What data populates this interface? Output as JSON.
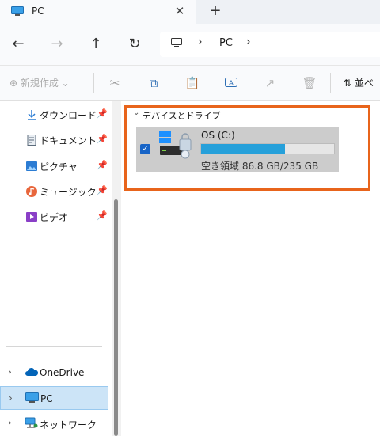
{
  "tab": {
    "title": "PC",
    "close_glyph": "✕",
    "new_tab_glyph": "+"
  },
  "nav": {
    "back_glyph": "←",
    "forward_glyph": "→",
    "up_glyph": "↑",
    "refresh_glyph": "↻",
    "breadcrumb": {
      "separator": "›",
      "location": "PC"
    }
  },
  "commands": {
    "new_label": "⊕ 新規作成 ⌄",
    "cut_glyph": "✂",
    "copy_glyph": "⧉",
    "paste_glyph": "📋",
    "rename_glyph": "A",
    "share_glyph": "↗",
    "delete_glyph": "🗑",
    "sort_label": "⇅ 並べ"
  },
  "sidebar": {
    "quick_access": [
      {
        "label": "ダウンロード",
        "icon": "download-icon"
      },
      {
        "label": "ドキュメント",
        "icon": "document-icon"
      },
      {
        "label": "ピクチャ",
        "icon": "picture-icon"
      },
      {
        "label": "ミュージック",
        "icon": "music-icon"
      },
      {
        "label": "ビデオ",
        "icon": "video-icon"
      }
    ],
    "pin_glyph": "📌",
    "tree": [
      {
        "label": "OneDrive",
        "icon": "onedrive-icon"
      },
      {
        "label": "PC",
        "icon": "pc-icon",
        "selected": true
      },
      {
        "label": "ネットワーク",
        "icon": "network-icon"
      }
    ],
    "chevron_glyph": "›"
  },
  "main": {
    "group_header": "デバイスとドライブ",
    "group_chevron": "⌄",
    "drive": {
      "name": "OS (C:)",
      "space_text": "空き領域 86.8 GB/235 GB",
      "used_fraction": 0.63,
      "checked": true,
      "check_glyph": "✓"
    }
  },
  "colors": {
    "highlight": "#e8641b",
    "usage_fill": "#26a0da",
    "selection": "#cce4f7",
    "accent": "#1764c7"
  }
}
